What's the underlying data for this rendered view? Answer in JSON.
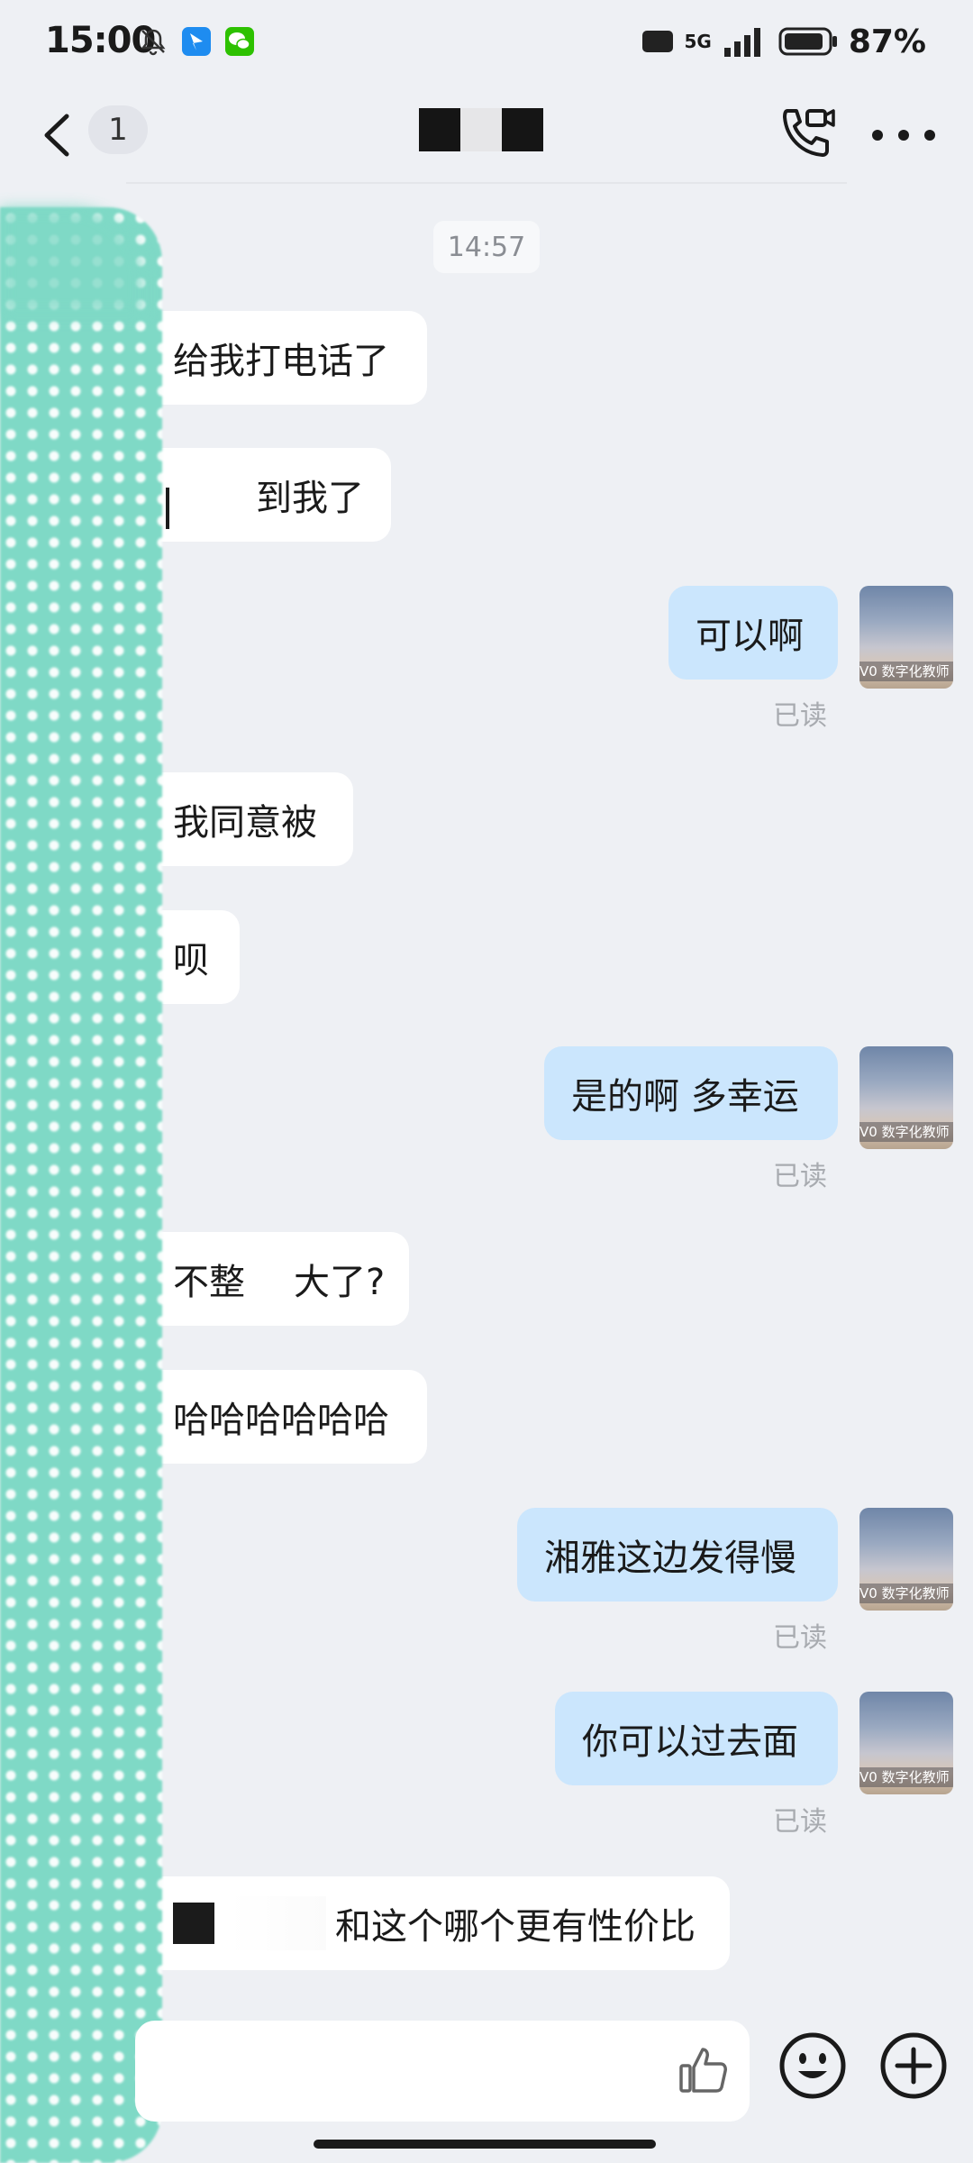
{
  "status_bar": {
    "time": "15:00",
    "network": "5G",
    "hd_label": "HD",
    "battery_percent": "87%",
    "icons": [
      "bell-off-icon",
      "app-notification-icon",
      "wechat-icon",
      "hd-icon",
      "signal-icon",
      "battery-icon"
    ]
  },
  "header": {
    "unread_count": "1",
    "icons": [
      "back-arrow-icon",
      "video-call-icon",
      "more-icon"
    ]
  },
  "chat": {
    "timestamp": "14:57",
    "read_label": "已读",
    "avatar_tag": "V0 数字化教师",
    "messages": [
      {
        "side": "in",
        "text": "给我打电话了"
      },
      {
        "side": "in",
        "text": "到我了",
        "redacted_prefix": true
      },
      {
        "side": "out",
        "text": "可以啊"
      },
      {
        "side": "in",
        "text": "我同意被"
      },
      {
        "side": "in",
        "text": "呗"
      },
      {
        "side": "out",
        "text": "是的啊 多幸运"
      },
      {
        "side": "in",
        "text_a": "不整",
        "text_b": "大了?"
      },
      {
        "side": "in",
        "text": "哈哈哈哈哈哈"
      },
      {
        "side": "out",
        "text": "湘雅这边发得慢"
      },
      {
        "side": "out",
        "text": "你可以过去面"
      },
      {
        "side": "in",
        "text": "和这个哪个更有性价比",
        "redacted_prefix": true
      }
    ]
  },
  "input_bar": {
    "value": "",
    "icons": [
      "thumbs-up-icon",
      "emoji-icon",
      "plus-icon"
    ]
  },
  "colors": {
    "background": "#eef0f4",
    "incoming_bubble": "#ffffff",
    "outgoing_bubble": "#cbe6fd",
    "redaction_strip": "#7fd9c6"
  }
}
